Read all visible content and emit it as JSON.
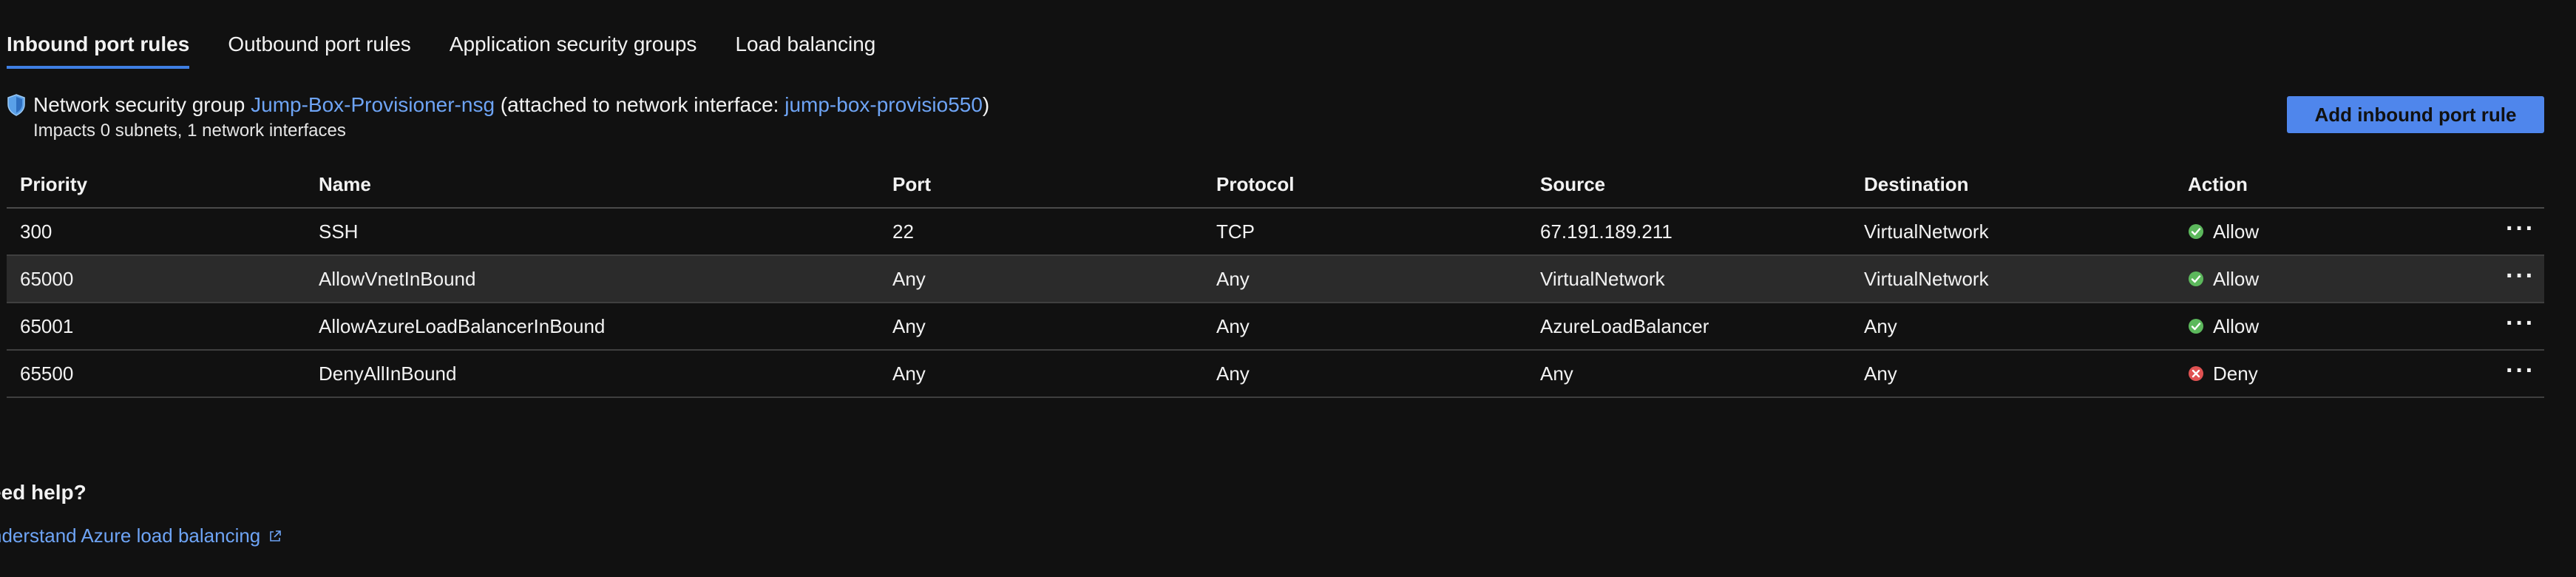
{
  "tabs": [
    {
      "label": "Inbound port rules",
      "active": true
    },
    {
      "label": "Outbound port rules",
      "active": false
    },
    {
      "label": "Application security groups",
      "active": false
    },
    {
      "label": "Load balancing",
      "active": false
    }
  ],
  "nsg": {
    "prefix": "Network security group",
    "name": "Jump-Box-Provisioner-nsg",
    "attached_prefix": "(attached to network interface:",
    "interface": "jump-box-provisio550",
    "attached_suffix": ")",
    "impacts": "Impacts 0 subnets, 1 network interfaces"
  },
  "add_button_label": "Add inbound port rule",
  "table": {
    "columns": [
      "Priority",
      "Name",
      "Port",
      "Protocol",
      "Source",
      "Destination",
      "Action"
    ],
    "rows": [
      {
        "priority": "300",
        "name": "SSH",
        "port": "22",
        "protocol": "TCP",
        "source": "67.191.189.211",
        "destination": "VirtualNetwork",
        "action": "Allow",
        "status": "allow"
      },
      {
        "priority": "65000",
        "name": "AllowVnetInBound",
        "port": "Any",
        "protocol": "Any",
        "source": "VirtualNetwork",
        "destination": "VirtualNetwork",
        "action": "Allow",
        "status": "allow"
      },
      {
        "priority": "65001",
        "name": "AllowAzureLoadBalancerInBound",
        "port": "Any",
        "protocol": "Any",
        "source": "AzureLoadBalancer",
        "destination": "Any",
        "action": "Allow",
        "status": "allow"
      },
      {
        "priority": "65500",
        "name": "DenyAllInBound",
        "port": "Any",
        "protocol": "Any",
        "source": "Any",
        "destination": "Any",
        "action": "Deny",
        "status": "deny"
      }
    ],
    "more_label": "···"
  },
  "help": {
    "title": "eed help?",
    "link": "nderstand Azure load balancing"
  },
  "colors": {
    "accent": "#4f86ec",
    "link": "#6ea4f5",
    "allow": "#5cb85c",
    "deny": "#e05252",
    "background": "#111111"
  },
  "icons": {
    "shield": "shield-icon",
    "allow": "check-circle-icon",
    "deny": "x-circle-icon",
    "external": "external-link-icon"
  }
}
